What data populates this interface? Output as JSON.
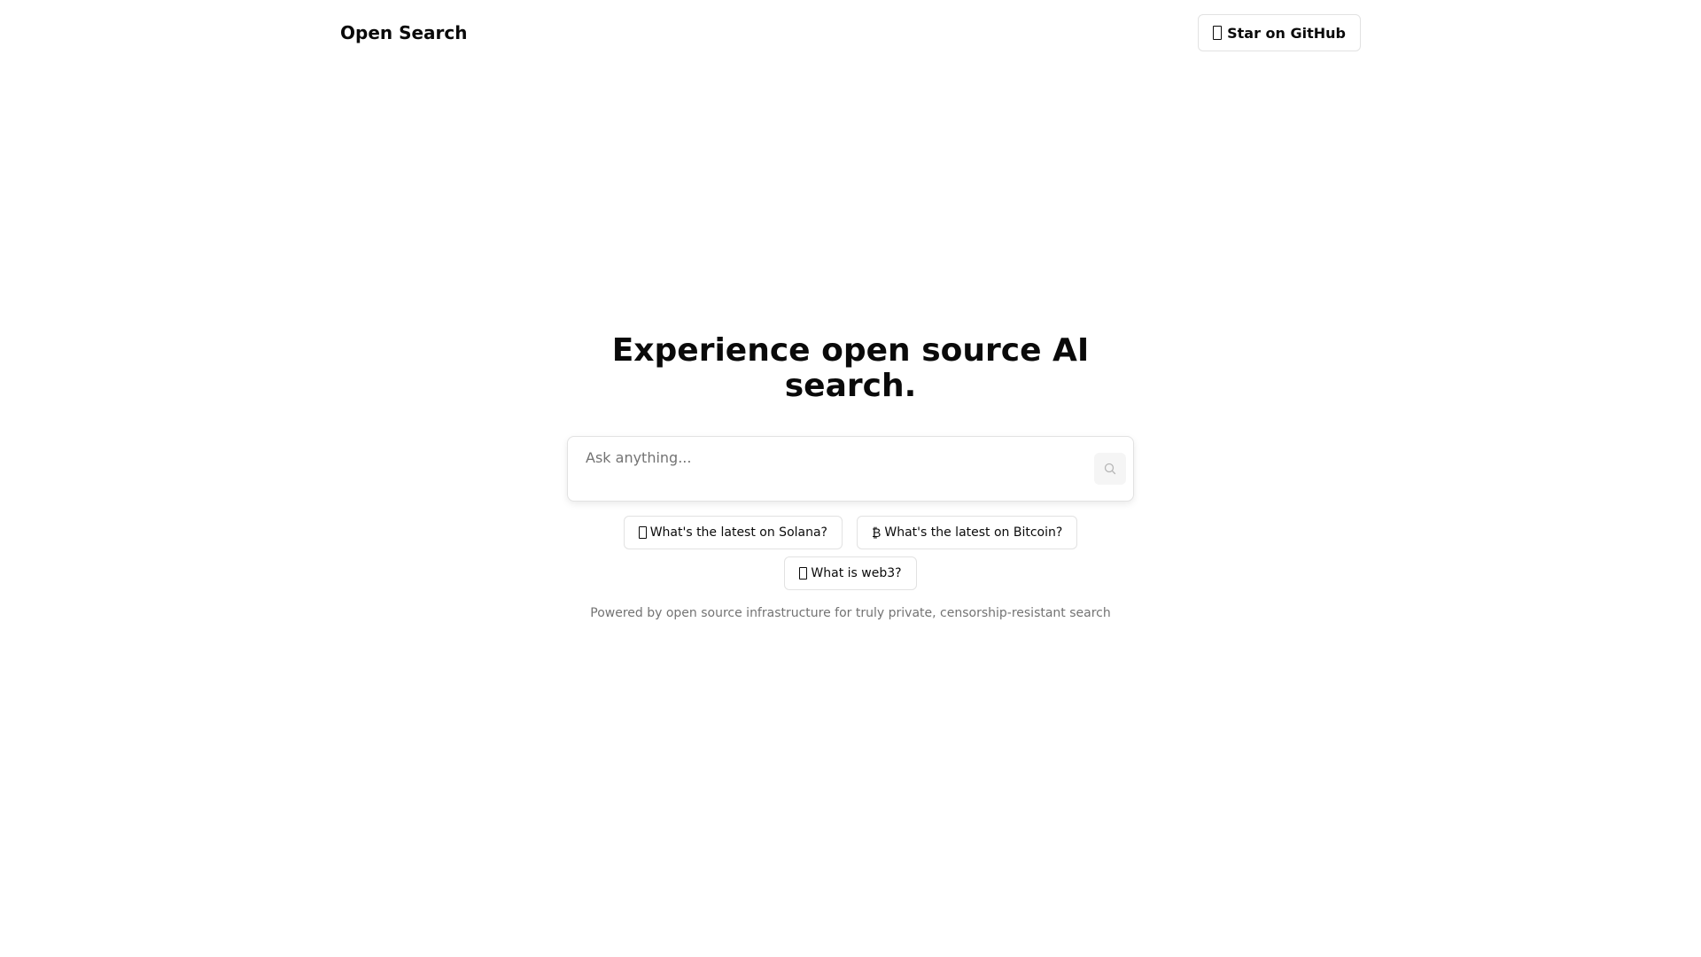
{
  "header": {
    "brand": "Open Search",
    "github_button_label": "Star on GitHub",
    "github_icon": "box-glyph-icon"
  },
  "hero": {
    "title": "Experience open source AI search."
  },
  "search": {
    "placeholder": "Ask anything...",
    "value": "",
    "button_icon": "search-icon"
  },
  "suggestions": [
    {
      "icon": "box-glyph-icon",
      "label": "What's the latest on Solana?"
    },
    {
      "icon": "bitcoin-icon",
      "glyph": "₿",
      "label": "What's the latest on Bitcoin?"
    },
    {
      "icon": "box-glyph-icon",
      "label": "What is web3?"
    }
  ],
  "footnote": "Powered by open source infrastructure for truly private, censorship-resistant search",
  "colors": {
    "text": "#0a0a0a",
    "muted": "#737373",
    "border": "#e2e2e2",
    "button_bg": "#f5f5f5"
  }
}
